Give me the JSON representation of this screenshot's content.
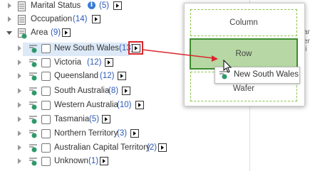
{
  "tree": {
    "marital": {
      "label": "Marital Status",
      "count": "(5)"
    },
    "occupation": {
      "label": "Occupation",
      "count": "(14)"
    },
    "area": {
      "label": "Area",
      "count": "(9)"
    },
    "items": [
      {
        "label": "New South Wales",
        "count": "(13)"
      },
      {
        "label": "Victoria",
        "count": "(12)"
      },
      {
        "label": "Queensland",
        "count": "(12)"
      },
      {
        "label": "South Australia",
        "count": "(8)"
      },
      {
        "label": "Western Australia",
        "count": "(10)"
      },
      {
        "label": "Tasmania",
        "count": "(5)"
      },
      {
        "label": "Northern Territory",
        "count": "(3)"
      },
      {
        "label": "Australian Capital Territory",
        "count": "(2)"
      },
      {
        "label": "Unknown",
        "count": "(1)"
      }
    ]
  },
  "popup": {
    "column": "Column",
    "row": "Row",
    "wafer": "Wafer"
  },
  "drag_tip": {
    "label": "New South Wales"
  },
  "side_text": {
    "line1": "arce",
    "line2": "er li"
  },
  "colors": {
    "accent": "#2c59b8",
    "highlight": "#dde9f7",
    "drop_active": "#b7d8a4",
    "arrow": "#d9262c"
  }
}
